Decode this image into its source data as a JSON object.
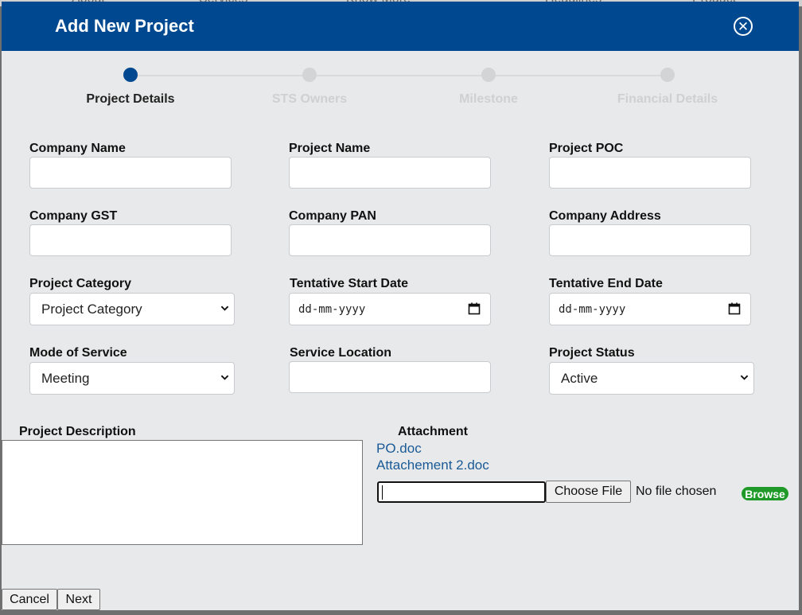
{
  "background_nav": [
    "About",
    "Services",
    "Know More",
    "Headlines",
    "Product"
  ],
  "modal": {
    "title": "Add New Project",
    "close_icon": "close-circle-icon"
  },
  "stepper": {
    "steps": [
      {
        "label": "Project Details",
        "active": true
      },
      {
        "label": "STS Owners",
        "active": false
      },
      {
        "label": "Milestone",
        "active": false
      },
      {
        "label": "Financial Details",
        "active": false
      }
    ]
  },
  "form": {
    "company_name": {
      "label": "Company Name",
      "value": ""
    },
    "project_name": {
      "label": "Project Name",
      "value": ""
    },
    "project_poc": {
      "label": "Project POC",
      "value": ""
    },
    "company_gst": {
      "label": "Company GST",
      "value": ""
    },
    "company_pan": {
      "label": "Company PAN",
      "value": ""
    },
    "company_address": {
      "label": "Company Address",
      "value": ""
    },
    "project_category": {
      "label": "Project Category",
      "selected": "Project Category"
    },
    "start_date": {
      "label": "Tentative Start Date",
      "value": "dd-mm-yyyy"
    },
    "end_date": {
      "label": "Tentative End Date",
      "value": "dd-mm-yyyy"
    },
    "mode_of_service": {
      "label": "Mode of Service",
      "selected": "Meeting"
    },
    "service_location": {
      "label": "Service Location",
      "value": ""
    },
    "project_status": {
      "label": "Project Status",
      "selected": "Active"
    },
    "project_description": {
      "label": "Project Description",
      "value": ""
    }
  },
  "attachment": {
    "label": "Attachment",
    "files": [
      "PO.doc",
      "Attachement 2.doc"
    ],
    "choose_file_label": "Choose File",
    "no_file_text": "No file chosen",
    "browse_label": "Browse"
  },
  "footer": {
    "cancel_label": "Cancel",
    "next_label": "Next"
  },
  "colors": {
    "header": "#004990",
    "active_step": "#004990",
    "browse": "#1f9a28",
    "link": "#1a5a96"
  }
}
